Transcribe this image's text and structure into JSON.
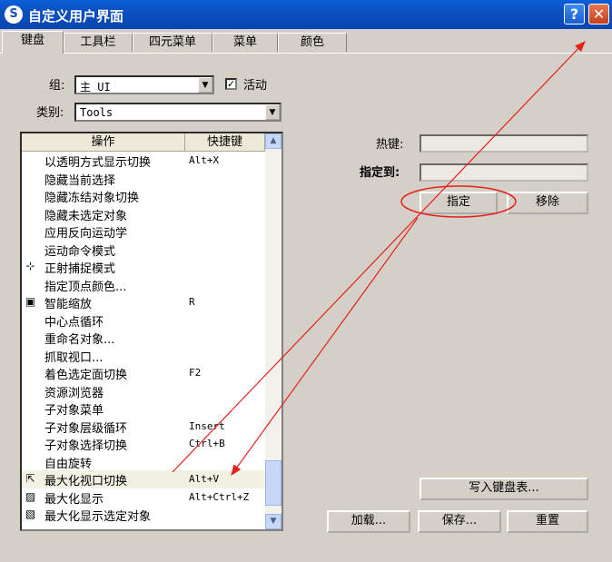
{
  "window": {
    "title": "自定义用户界面",
    "icon": "3ds-max-logo-icon",
    "help_label": "?",
    "close_label": "✕"
  },
  "tabs": [
    {
      "label": "键盘",
      "active": true
    },
    {
      "label": "工具栏",
      "active": false
    },
    {
      "label": "四元菜单",
      "active": false
    },
    {
      "label": "菜单",
      "active": false
    },
    {
      "label": "颜色",
      "active": false
    }
  ],
  "form": {
    "group_label": "组:",
    "group_value": "主 UI",
    "active_label": "活动",
    "active_checked": true,
    "category_label": "类别:",
    "category_value": "Tools"
  },
  "list": {
    "col_action": "操作",
    "col_shortcut": "快捷键",
    "rows": [
      {
        "op": "以透明方式显示切换",
        "key": "Alt+X",
        "icon": ""
      },
      {
        "op": "隐藏当前选择",
        "key": "",
        "icon": ""
      },
      {
        "op": "隐藏冻结对象切换",
        "key": "",
        "icon": ""
      },
      {
        "op": "隐藏未选定对象",
        "key": "",
        "icon": ""
      },
      {
        "op": "应用反向运动学",
        "key": "",
        "icon": ""
      },
      {
        "op": "运动命令模式",
        "key": "",
        "icon": ""
      },
      {
        "op": "正射捕捉模式",
        "key": "",
        "icon": "ortho-snap-icon"
      },
      {
        "op": "指定顶点颜色...",
        "key": "",
        "icon": ""
      },
      {
        "op": "智能缩放",
        "key": "R",
        "icon": "smart-scale-icon"
      },
      {
        "op": "中心点循环",
        "key": "",
        "icon": ""
      },
      {
        "op": "重命名对象...",
        "key": "",
        "icon": ""
      },
      {
        "op": "抓取视口...",
        "key": "",
        "icon": ""
      },
      {
        "op": "着色选定面切换",
        "key": "F2",
        "icon": ""
      },
      {
        "op": "资源浏览器",
        "key": "",
        "icon": ""
      },
      {
        "op": "子对象菜单",
        "key": "",
        "icon": ""
      },
      {
        "op": "子对象层级循环",
        "key": "Insert",
        "icon": ""
      },
      {
        "op": "子对象选择切换",
        "key": "Ctrl+B",
        "icon": ""
      },
      {
        "op": "自由旋转",
        "key": "",
        "icon": ""
      },
      {
        "op": "最大化视口切换",
        "key": "Alt+V",
        "icon": "maximize-viewport-icon",
        "selected": true
      },
      {
        "op": "最大化显示",
        "key": "Alt+Ctrl+Z",
        "icon": "zoom-extents-icon"
      },
      {
        "op": "最大化显示选定对象",
        "key": "",
        "icon": "zoom-extents-selected-icon"
      }
    ]
  },
  "right": {
    "hotkey_label": "热键:",
    "hotkey_value": "",
    "assigned_label": "指定到:",
    "assigned_value": "",
    "assign_button": "指定",
    "remove_button": "移除",
    "write_keyboard_button": "写入键盘表...",
    "load_button": "加载...",
    "save_button": "保存...",
    "reset_button": "重置"
  },
  "annotation": {
    "color": "#e8201a"
  }
}
